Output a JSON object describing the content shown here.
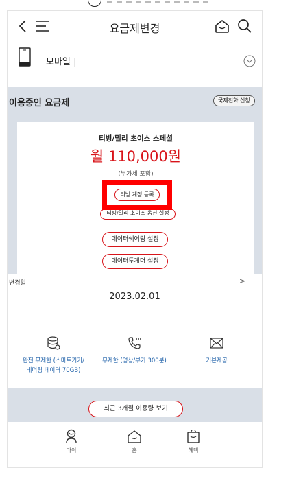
{
  "header": {
    "title": "요금제변경"
  },
  "device": {
    "label": "모바일",
    "separator": "|"
  },
  "plan_section": {
    "title": "이용중인 요금제",
    "intl_call_button": "국제전화 신청"
  },
  "plan": {
    "name": "티빙/밀리 초이스 스페셜",
    "price": "월 110,000원",
    "vat_note": "(부가세 포함)",
    "tving_button": "티빙 계정 등록",
    "option_button": "티빙/밀리 초이스 옵션 설정",
    "data_share_button": "데이터쉐어링 설정",
    "data_together_button": "데이터투게더 설정"
  },
  "change_date": {
    "label": "변경일",
    "arrow": ">",
    "value": "2023.02.01"
  },
  "features": [
    {
      "icon": "database-icon",
      "label_line1": "완전 무제한 (스마트기기/",
      "label_line2": "테더링 데이터 70GB)"
    },
    {
      "icon": "phone-call-icon",
      "label_line1": "무제한 (영상/부가 300분)",
      "label_line2": ""
    },
    {
      "icon": "envelope-icon",
      "label_line1": "기본제공",
      "label_line2": ""
    }
  ],
  "usage_button": "최근 3개월 이용량 보기",
  "bottom_nav": {
    "my": "마이",
    "home": "홈",
    "benefit": "혜택"
  },
  "colors": {
    "accent": "#d8141a",
    "highlight": "#ff0000",
    "section_bg": "#d9dfe7",
    "feature_text": "#1d5fa8"
  }
}
